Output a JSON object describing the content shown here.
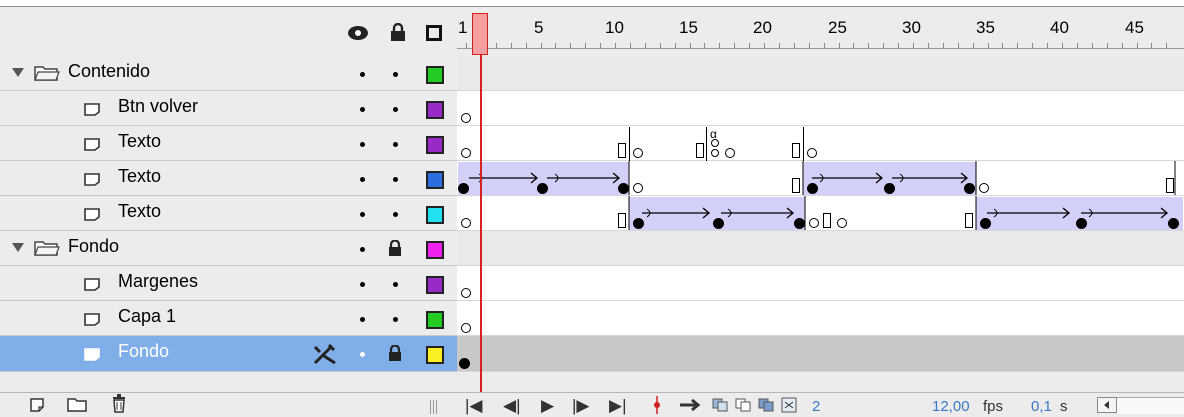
{
  "header": {
    "eye_icon": "eye-icon",
    "lock_icon": "lock-icon",
    "outline_icon": "outline-square-icon",
    "frame_numbers": [
      "1",
      "5",
      "10",
      "15",
      "20",
      "25",
      "30",
      "35",
      "40",
      "45"
    ]
  },
  "layers": [
    {
      "name": "Contenido",
      "type": "folder",
      "visible": true,
      "locked": false,
      "color": "#22cc22"
    },
    {
      "name": "Btn volver",
      "type": "layer",
      "visible": true,
      "locked": false,
      "color": "#9a2ac8"
    },
    {
      "name": "Texto",
      "type": "layer",
      "visible": true,
      "locked": false,
      "color": "#9a2ac8"
    },
    {
      "name": "Texto",
      "type": "layer",
      "visible": true,
      "locked": false,
      "color": "#2a6ee0"
    },
    {
      "name": "Texto",
      "type": "layer",
      "visible": true,
      "locked": false,
      "color": "#22e0f0"
    },
    {
      "name": "Fondo",
      "type": "folder",
      "visible": true,
      "locked": true,
      "color": "#f020f0"
    },
    {
      "name": "Margenes",
      "type": "layer",
      "visible": true,
      "locked": false,
      "color": "#9a2ac8"
    },
    {
      "name": "Capa 1",
      "type": "layer",
      "visible": true,
      "locked": false,
      "color": "#22cc22"
    },
    {
      "name": "Fondo",
      "type": "layer",
      "visible": true,
      "locked": true,
      "color": "#f8f020",
      "selected": true
    }
  ],
  "footer": {
    "current_frame": "2",
    "frame_rate": "12,00",
    "fps_label": "fps",
    "elapsed": "0,1",
    "seconds_label": "s"
  },
  "colors": {
    "playhead": "#d82020",
    "selection": "#7faee8",
    "tween": "#d2d0f8"
  }
}
